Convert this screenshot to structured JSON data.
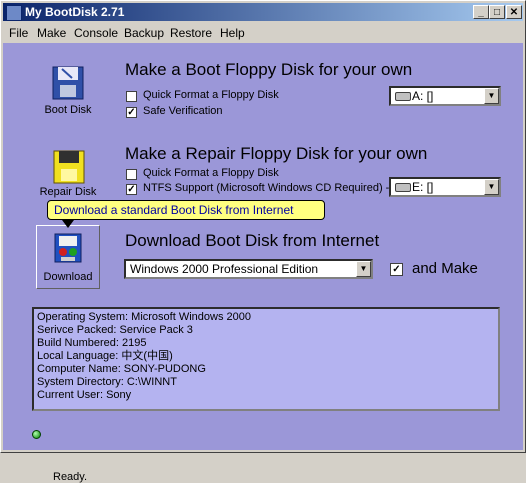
{
  "window": {
    "title": "My BootDisk 2.71",
    "controls": {
      "minimize": "_",
      "maximize": "□",
      "close": "✕"
    }
  },
  "menu": [
    {
      "label": "File"
    },
    {
      "label": "Make"
    },
    {
      "label": "Console"
    },
    {
      "label": "Backup"
    },
    {
      "label": "Restore"
    },
    {
      "label": "Help"
    }
  ],
  "boot": {
    "icon_label": "Boot Disk",
    "heading": "Make a Boot Floppy Disk for your own",
    "quick_format": {
      "label": "Quick Format a Floppy Disk",
      "checked": false
    },
    "safe_verify": {
      "label": "Safe Verification",
      "checked": true
    },
    "drive": "A: []"
  },
  "repair": {
    "icon_label": "Repair Disk",
    "heading": "Make a Repair Floppy Disk for your own",
    "quick_format": {
      "label": "Quick Format a Floppy Disk",
      "checked": false
    },
    "ntfs": {
      "label": "NTFS Support (Microsoft Windows CD Required) ->",
      "checked": true
    },
    "drive": "E: []"
  },
  "download": {
    "tooltip": "Download a standard Boot Disk from Internet",
    "icon_label": "Download",
    "heading": "Download Boot Disk from Internet",
    "edition": "Windows 2000 Professional Edition",
    "and_make": {
      "label": "and Make",
      "checked": true
    }
  },
  "system_info": [
    "Operating System: Microsoft Windows 2000",
    "Serivce Packed: Service Pack 3",
    "Build Numbered: 2195",
    "Local Language: 中文(中国)",
    "Computer Name: SONY-PUDONG",
    "System Directory: C:\\WINNT",
    "Current User: Sony"
  ],
  "status": {
    "text": "Ready."
  },
  "colors": {
    "client_bg": "#9b97d8",
    "info_bg": "#b4b3f0",
    "tooltip_bg": "#ffff80",
    "title_start": "#0a246a"
  }
}
